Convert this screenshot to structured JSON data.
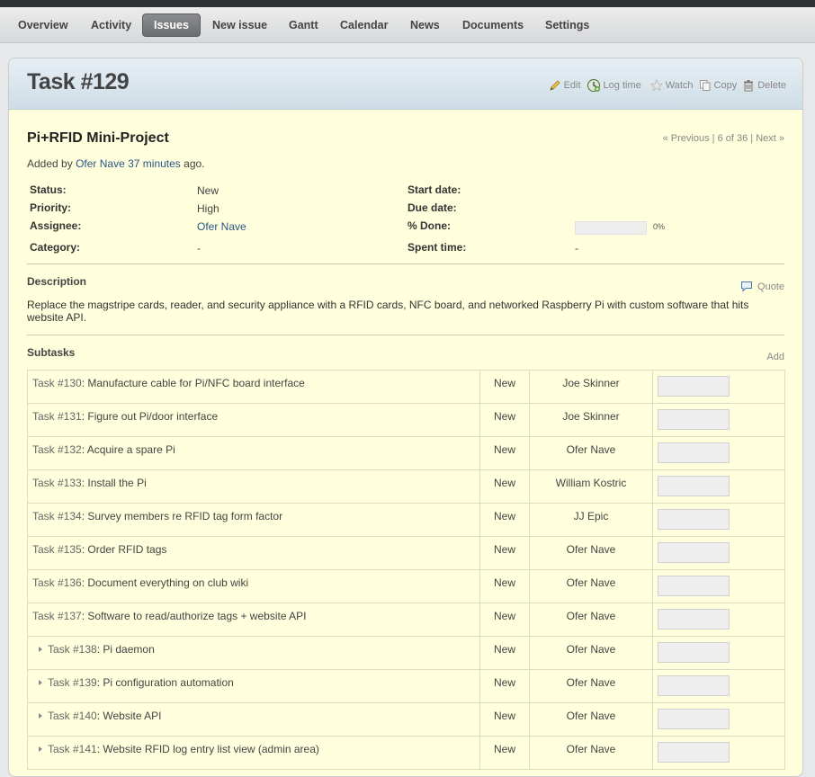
{
  "menu": {
    "tabs": [
      {
        "label": "Overview"
      },
      {
        "label": "Activity"
      },
      {
        "label": "Issues"
      },
      {
        "label": "New issue"
      },
      {
        "label": "Gantt"
      },
      {
        "label": "Calendar"
      },
      {
        "label": "News"
      },
      {
        "label": "Documents"
      },
      {
        "label": "Settings"
      }
    ],
    "active": "Issues"
  },
  "issue": {
    "title": "Task #129",
    "subject": "Pi+RFID Mini-Project",
    "added_by_prefix": "Added by",
    "author": "Ofer Nave",
    "age": "37 minutes",
    "age_suffix": "ago."
  },
  "actions": {
    "edit": "Edit",
    "log_time": "Log time",
    "watch": "Watch",
    "copy": "Copy",
    "delete": "Delete"
  },
  "nav": {
    "previous": "« Previous",
    "position": "6 of 36",
    "next": "Next »"
  },
  "attributes": {
    "status_label": "Status:",
    "status": "New",
    "priority_label": "Priority:",
    "priority": "High",
    "assignee_label": "Assignee:",
    "assignee": "Ofer Nave",
    "category_label": "Category:",
    "category": "-",
    "start_date_label": "Start date:",
    "due_date_label": "Due date:",
    "done_label": "% Done:",
    "done_value": 0,
    "done_text": "0%",
    "spent_time_label": "Spent time:",
    "spent_time": "-"
  },
  "description": {
    "heading": "Description",
    "quote": "Quote",
    "text": "Replace the magstripe cards, reader, and security appliance with a RFID cards, NFC board, and networked Raspberry Pi with custom software that hits website API."
  },
  "subtasks": {
    "heading": "Subtasks",
    "add": "Add",
    "rows": [
      {
        "ref": "Task #130",
        "subject": ": Manufacture cable for Pi/NFC board interface",
        "status": "New",
        "assignee": "Joe Skinner",
        "done": 0,
        "child": false
      },
      {
        "ref": "Task #131",
        "subject": ": Figure out Pi/door interface",
        "status": "New",
        "assignee": "Joe Skinner",
        "done": 0,
        "child": false
      },
      {
        "ref": "Task #132",
        "subject": ": Acquire a spare Pi",
        "status": "New",
        "assignee": "Ofer Nave",
        "done": 0,
        "child": false
      },
      {
        "ref": "Task #133",
        "subject": ": Install the Pi",
        "status": "New",
        "assignee": "William Kostric",
        "done": 0,
        "child": false
      },
      {
        "ref": "Task #134",
        "subject": ": Survey members re RFID tag form factor",
        "status": "New",
        "assignee": "JJ Epic",
        "done": 0,
        "child": false
      },
      {
        "ref": "Task #135",
        "subject": ": Order RFID tags",
        "status": "New",
        "assignee": "Ofer Nave",
        "done": 0,
        "child": false
      },
      {
        "ref": "Task #136",
        "subject": ": Document everything on club wiki",
        "status": "New",
        "assignee": "Ofer Nave",
        "done": 0,
        "child": false
      },
      {
        "ref": "Task #137",
        "subject": ": Software to read/authorize tags + website API",
        "status": "New",
        "assignee": "Ofer Nave",
        "done": 0,
        "child": false
      },
      {
        "ref": "Task #138",
        "subject": ": Pi daemon",
        "status": "New",
        "assignee": "Ofer Nave",
        "done": 0,
        "child": true
      },
      {
        "ref": "Task #139",
        "subject": ": Pi configuration automation",
        "status": "New",
        "assignee": "Ofer Nave",
        "done": 0,
        "child": true
      },
      {
        "ref": "Task #140",
        "subject": ": Website API",
        "status": "New",
        "assignee": "Ofer Nave",
        "done": 0,
        "child": true
      },
      {
        "ref": "Task #141",
        "subject": ": Website RFID log entry list view (admin area)",
        "status": "New",
        "assignee": "Ofer Nave",
        "done": 0,
        "child": true
      }
    ]
  },
  "colors": {
    "content_bg": "#ffffdd",
    "link": "#2a5685",
    "active_tab": "#6b6d70"
  }
}
